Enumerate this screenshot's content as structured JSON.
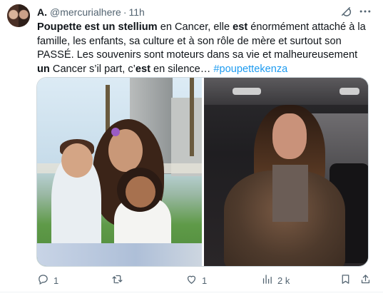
{
  "tweet": {
    "display_name": "A.",
    "handle": "@mercurialhere",
    "separator": "·",
    "time": "11h",
    "text": {
      "p1": "Poupette est un stellium",
      "p2": " en Cancer, elle ",
      "p3": "est",
      "p4": " énormément attaché à la famille, les enfants, sa culture et à son rôle de mère et surtout son PASSÉ. Les souvenirs sont moteurs dans sa vie et malheureusement ",
      "p5": "un",
      "p6": " Cancer s’il part, c’",
      "p7": "est",
      "p8": " en silence… ",
      "hashtag": "#poupettekenza"
    },
    "actions": {
      "reply_count": "1",
      "retweet_count": "",
      "like_count": "1",
      "views_count": "2 k"
    }
  },
  "icons": {
    "grok": "grok-icon",
    "more": "more-icon",
    "reply": "reply-icon",
    "retweet": "retweet-icon",
    "like": "heart-icon",
    "views": "views-icon",
    "bookmark": "bookmark-icon",
    "share": "share-icon"
  },
  "colors": {
    "text": "#0f1419",
    "secondary": "#536471",
    "link": "#1d9bf0",
    "border": "#cfd9de"
  }
}
